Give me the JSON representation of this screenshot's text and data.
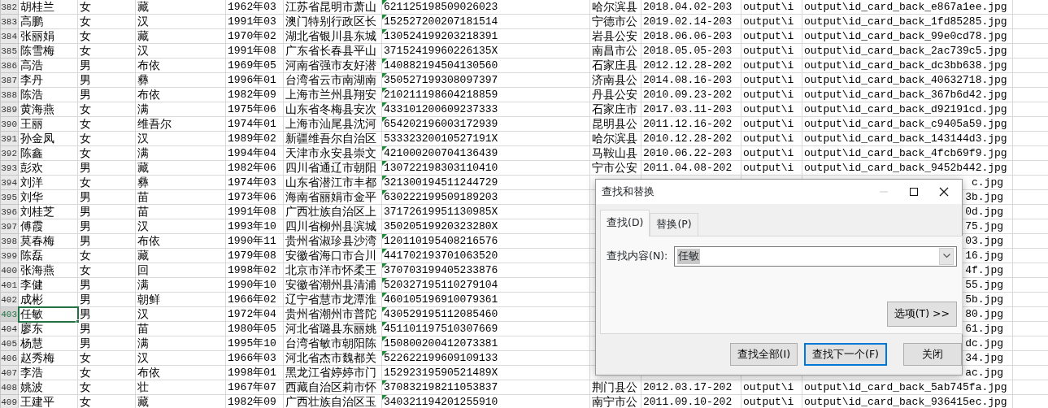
{
  "sheet": {
    "rows": [
      {
        "row_number": "382",
        "selected": false,
        "name": "胡桂兰",
        "gender": "女",
        "ethnicity": "藏",
        "birth": "1962年03",
        "address": "江苏省昆明市萧山",
        "id_number": "621125198509026023",
        "id_flag": true,
        "issuer": "哈尔滨县",
        "validity": "2018.04.02-203",
        "front_path": "output\\i",
        "back_path": "output\\id_card_back_e867a1ee.jpg"
      },
      {
        "row_number": "383",
        "selected": false,
        "name": "高鹏",
        "gender": "女",
        "ethnicity": "汉",
        "birth": "1991年03",
        "address": "澳门特别行政区长",
        "id_number": "152527200207181514",
        "id_flag": true,
        "issuer": "宁德市公",
        "validity": "2019.02.14-203",
        "front_path": "output\\i",
        "back_path": "output\\id_card_back_1fd85285.jpg"
      },
      {
        "row_number": "384",
        "selected": false,
        "name": "张丽娟",
        "gender": "女",
        "ethnicity": "藏",
        "birth": "1970年02",
        "address": "湖北省银川县东城",
        "id_number": "130524199203218391",
        "id_flag": true,
        "issuer": "岩县公安",
        "validity": "2018.06.06-203",
        "front_path": "output\\i",
        "back_path": "output\\id_card_back_99e0cd78.jpg"
      },
      {
        "row_number": "385",
        "selected": false,
        "name": "陈雪梅",
        "gender": "女",
        "ethnicity": "汉",
        "birth": "1991年08",
        "address": "广东省长春县平山",
        "id_number": "37152419960226135X",
        "id_flag": false,
        "issuer": "南昌市公",
        "validity": "2018.05.05-203",
        "front_path": "output\\i",
        "back_path": "output\\id_card_back_2ac739c5.jpg"
      },
      {
        "row_number": "386",
        "selected": false,
        "name": "高浩",
        "gender": "男",
        "ethnicity": "布依",
        "birth": "1969年05",
        "address": "河南省强市友好潜",
        "id_number": "140882194504130560",
        "id_flag": true,
        "issuer": "石家庄县",
        "validity": "2012.12.28-202",
        "front_path": "output\\i",
        "back_path": "output\\id_card_back_dc3bb638.jpg"
      },
      {
        "row_number": "387",
        "selected": false,
        "name": "李丹",
        "gender": "男",
        "ethnicity": "彝",
        "birth": "1996年01",
        "address": "台湾省云市南湖南",
        "id_number": "350527199308097397",
        "id_flag": true,
        "issuer": "济南县公",
        "validity": "2014.08.16-203",
        "front_path": "output\\i",
        "back_path": "output\\id_card_back_40632718.jpg"
      },
      {
        "row_number": "388",
        "selected": false,
        "name": "陈浩",
        "gender": "男",
        "ethnicity": "布依",
        "birth": "1982年09",
        "address": "上海市兰州县翔安",
        "id_number": "210211198604218859",
        "id_flag": true,
        "issuer": "丹县公安",
        "validity": "2010.09.23-202",
        "front_path": "output\\i",
        "back_path": "output\\id_card_back_367b6d42.jpg"
      },
      {
        "row_number": "389",
        "selected": false,
        "name": "黄海燕",
        "gender": "女",
        "ethnicity": "满",
        "birth": "1975年06",
        "address": "山东省冬梅县安次",
        "id_number": "433101200609237333",
        "id_flag": true,
        "issuer": "石家庄市",
        "validity": "2017.03.11-203",
        "front_path": "output\\i",
        "back_path": "output\\id_card_back_d92191cd.jpg"
      },
      {
        "row_number": "390",
        "selected": false,
        "name": "王丽",
        "gender": "女",
        "ethnicity": "维吾尔",
        "birth": "1974年01",
        "address": "上海市汕尾县沈河",
        "id_number": "654202196003172939",
        "id_flag": true,
        "issuer": "昆明县公",
        "validity": "2011.12.16-202",
        "front_path": "output\\i",
        "back_path": "output\\id_card_back_c9405a59.jpg"
      },
      {
        "row_number": "391",
        "selected": false,
        "name": "孙金凤",
        "gender": "女",
        "ethnicity": "汉",
        "birth": "1989年02",
        "address": "新疆维吾尔自治区",
        "id_number": "53332320010527191X",
        "id_flag": false,
        "issuer": "哈尔滨县",
        "validity": "2010.12.28-202",
        "front_path": "output\\i",
        "back_path": "output\\id_card_back_143144d3.jpg"
      },
      {
        "row_number": "392",
        "selected": false,
        "name": "陈鑫",
        "gender": "女",
        "ethnicity": "满",
        "birth": "1994年04",
        "address": "天津市永安县崇文",
        "id_number": "421000200704136439",
        "id_flag": true,
        "issuer": "马鞍山县",
        "validity": "2010.06.22-203",
        "front_path": "output\\i",
        "back_path": "output\\id_card_back_4fcb69f9.jpg"
      },
      {
        "row_number": "393",
        "selected": false,
        "name": "彭欢",
        "gender": "男",
        "ethnicity": "藏",
        "birth": "1982年06",
        "address": "四川省通辽市朝阳",
        "id_number": "130722198303110410",
        "id_flag": true,
        "issuer": "宁市公安",
        "validity": "2011.04.08-202",
        "front_path": "output\\i",
        "back_path": "output\\id_card_back_9452b442.jpg"
      },
      {
        "row_number": "394",
        "selected": false,
        "name": "刘洋",
        "gender": "女",
        "ethnicity": "彝",
        "birth": "1974年03",
        "address": "山东省潜江市丰都",
        "id_number": "321300194511244729",
        "id_flag": true,
        "back_path": "c.jpg"
      },
      {
        "row_number": "395",
        "selected": false,
        "name": "刘华",
        "gender": "男",
        "ethnicity": "苗",
        "birth": "1973年06",
        "address": "海南省丽娟市金平",
        "id_number": "630222199509189203",
        "id_flag": true,
        "back_path": "3b.jpg"
      },
      {
        "row_number": "396",
        "selected": false,
        "name": "刘桂芝",
        "gender": "男",
        "ethnicity": "苗",
        "birth": "1991年08",
        "address": "广西壮族自治区上",
        "id_number": "37172619951130985X",
        "id_flag": false,
        "back_path": "0d.jpg"
      },
      {
        "row_number": "397",
        "selected": false,
        "name": "傅霞",
        "gender": "男",
        "ethnicity": "汉",
        "birth": "1993年10",
        "address": "四川省柳州县滨城",
        "id_number": "35020519920323280X",
        "id_flag": false,
        "back_path": "75.jpg"
      },
      {
        "row_number": "398",
        "selected": false,
        "name": "莫春梅",
        "gender": "男",
        "ethnicity": "布依",
        "birth": "1990年11",
        "address": "贵州省淑珍县沙湾",
        "id_number": "120110195408216576",
        "id_flag": true,
        "back_path": "03.jpg"
      },
      {
        "row_number": "399",
        "selected": false,
        "name": "陈磊",
        "gender": "女",
        "ethnicity": "藏",
        "birth": "1979年08",
        "address": "安徽省海口市合川",
        "id_number": "441702193701063520",
        "id_flag": true,
        "back_path": "16.jpg"
      },
      {
        "row_number": "400",
        "selected": false,
        "name": "张海燕",
        "gender": "女",
        "ethnicity": "回",
        "birth": "1998年02",
        "address": "北京市洋市怀柔王",
        "id_number": "370703199405233876",
        "id_flag": true,
        "back_path": "4f.jpg"
      },
      {
        "row_number": "401",
        "selected": false,
        "name": "李健",
        "gender": "男",
        "ethnicity": "满",
        "birth": "1990年10",
        "address": "安徽省潮州县清浦",
        "id_number": "520327195110279104",
        "id_flag": true,
        "back_path": "55.jpg"
      },
      {
        "row_number": "402",
        "selected": false,
        "name": "成彬",
        "gender": "男",
        "ethnicity": "朝鲜",
        "birth": "1966年02",
        "address": "辽宁省慧市龙潭淮",
        "id_number": "460105196910079361",
        "id_flag": true,
        "back_path": "5b.jpg"
      },
      {
        "row_number": "403",
        "selected": true,
        "name": "任敏",
        "gender": "男",
        "ethnicity": "汉",
        "birth": "1972年04",
        "address": "贵州省潮州市普陀",
        "id_number": "430529195112085460",
        "id_flag": true,
        "back_path": "80.jpg"
      },
      {
        "row_number": "404",
        "selected": false,
        "name": "廖东",
        "gender": "男",
        "ethnicity": "苗",
        "birth": "1980年05",
        "address": "河北省璐县东丽姚",
        "id_number": "451101197510307669",
        "id_flag": true,
        "back_path": "61.jpg"
      },
      {
        "row_number": "405",
        "selected": false,
        "name": "杨慧",
        "gender": "男",
        "ethnicity": "满",
        "birth": "1995年10",
        "address": "台湾省敏市朝阳陈",
        "id_number": "150800200412073381",
        "id_flag": true,
        "back_path": "dc.jpg"
      },
      {
        "row_number": "406",
        "selected": false,
        "name": "赵秀梅",
        "gender": "女",
        "ethnicity": "汉",
        "birth": "1966年03",
        "address": "河北省杰市魏都关",
        "id_number": "522622199609109133",
        "id_flag": true,
        "back_path": "34.jpg"
      },
      {
        "row_number": "407",
        "selected": false,
        "name": "李浩",
        "gender": "女",
        "ethnicity": "布依",
        "birth": "1998年01",
        "address": "黑龙江省婷婷市门",
        "id_number": "15292319590521489X",
        "id_flag": false,
        "back_path": "ac.jpg"
      },
      {
        "row_number": "408",
        "selected": false,
        "name": "姚波",
        "gender": "女",
        "ethnicity": "壮",
        "birth": "1967年07",
        "address": "西藏自治区莉市怀",
        "id_number": "370832198211053837",
        "id_flag": true,
        "issuer": "荆门县公",
        "validity": "2012.03.17-202",
        "front_path": "output\\i",
        "back_path": "output\\id_card_back_5ab745fa.jpg"
      },
      {
        "row_number": "409",
        "selected": false,
        "name": "王建平",
        "gender": "女",
        "ethnicity": "藏",
        "birth": "1982年09",
        "address": "广西壮族自治区玉",
        "id_number": "340321194201255910",
        "id_flag": true,
        "issuer": "南宁市公",
        "validity": "2011.09.10-202",
        "front_path": "output\\i",
        "back_path": "output\\id_card_back_936415ec.jpg"
      }
    ]
  },
  "dialog": {
    "title": "查找和替换",
    "window_controls": [
      {
        "kind": "minimize",
        "disabled": true
      },
      {
        "kind": "maximize",
        "disabled": false
      },
      {
        "kind": "close",
        "disabled": false
      }
    ],
    "tabs": [
      {
        "label": "查找(D)",
        "selected": true
      },
      {
        "label": "替换(P)",
        "selected": false
      }
    ],
    "find_label": "查找内容(N):",
    "find_value": "任敏",
    "options_button": "选项(T) >>",
    "buttons": [
      {
        "label": "查找全部(I)",
        "focused": false
      },
      {
        "label": "查找下一个(F)",
        "focused": true
      },
      {
        "label": "关闭",
        "focused": false
      }
    ]
  }
}
